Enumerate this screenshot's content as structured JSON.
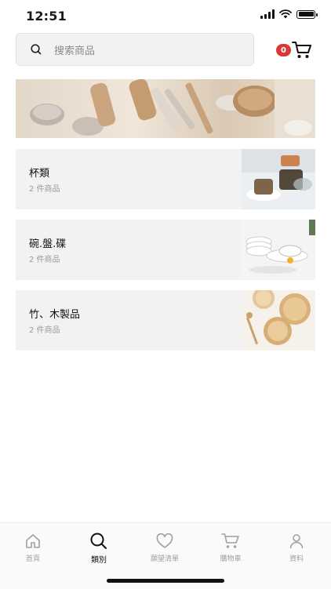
{
  "status_bar": {
    "time": "12:51"
  },
  "search": {
    "placeholder": "搜索商品"
  },
  "cart": {
    "badge_count": "0"
  },
  "categories": [
    {
      "name": "杯類",
      "count": "2 件商品"
    },
    {
      "name": "碗.盤.碟",
      "count": "2 件商品"
    },
    {
      "name": "竹、木製品",
      "count": "2 件商品"
    }
  ],
  "tab_bar": {
    "items": [
      {
        "label": "首頁",
        "icon": "home-icon"
      },
      {
        "label": "類別",
        "icon": "search-icon"
      },
      {
        "label": "願望清單",
        "icon": "heart-icon"
      },
      {
        "label": "購物車",
        "icon": "cart-icon"
      },
      {
        "label": "資料",
        "icon": "user-icon"
      }
    ],
    "active_index": 1
  }
}
